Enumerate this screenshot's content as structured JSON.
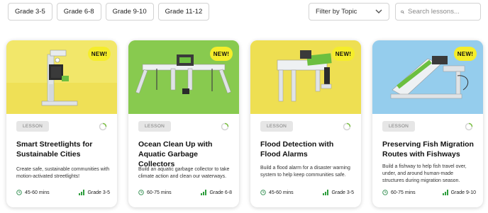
{
  "filters": {
    "grades": [
      "Grade 3-5",
      "Grade 6-8",
      "Grade 9-10",
      "Grade 11-12"
    ],
    "topic_select": "Filter by Topic",
    "search_placeholder": "Search lessons..."
  },
  "cards": [
    {
      "badge": "NEW!",
      "tag": "LESSON",
      "title": "Smart Streetlights for Sustainable Cities",
      "description": "Create safe, sustainable communities with motion-activated streetlights!",
      "duration": "45-60 mins",
      "grade": "Grade 3-5",
      "bg": "#f2e76a"
    },
    {
      "badge": "NEW!",
      "tag": "LESSON",
      "title": "Ocean Clean Up with Aquatic Garbage Collectors",
      "description": "Build an aquatic garbage collector to take climate action and clean our waterways.",
      "duration": "60-75 mins",
      "grade": "Grade 6-8",
      "bg": "#8fcf55"
    },
    {
      "badge": "NEW!",
      "tag": "LESSON",
      "title": "Flood Detection with Flood Alarms",
      "description": "Build a flood alarm for a disaster warning system to help keep communities safe.",
      "duration": "45-60 mins",
      "grade": "Grade 3-5",
      "bg": "#f1e45c"
    },
    {
      "badge": "NEW!",
      "tag": "LESSON",
      "title": "Preserving Fish Migration Routes with Fishways",
      "description": "Build a fishway to help fish travel over, under, and around human-made structures during migration season.",
      "duration": "60-75 mins",
      "grade": "Grade 9-10",
      "bg": "#9fd3ef"
    }
  ],
  "colors": {
    "clock": "#2a8a4a",
    "grade_bars": "#2f9e3e",
    "badge": "#f5ed2a"
  }
}
